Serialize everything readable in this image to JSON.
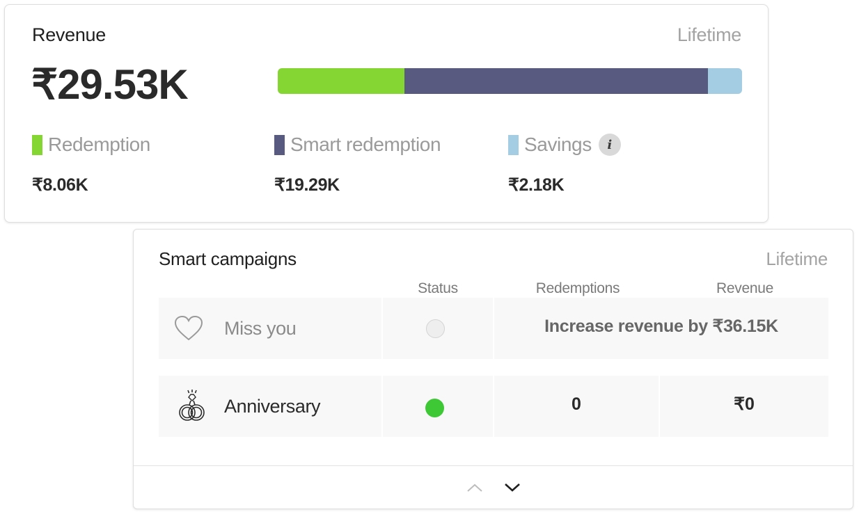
{
  "revenue": {
    "title": "Revenue",
    "period": "Lifetime",
    "total": "₹29.53K",
    "bar": [
      {
        "key": "redemption",
        "fraction": 0.273,
        "color": "#86d633"
      },
      {
        "key": "smart_redemption",
        "fraction": 0.653,
        "color": "#585a80"
      },
      {
        "key": "savings",
        "fraction": 0.074,
        "color": "#a4cce3"
      }
    ],
    "legend": [
      {
        "label": "Redemption",
        "value": "₹8.06K",
        "color": "#86d633"
      },
      {
        "label": "Smart redemption",
        "value": "₹19.29K",
        "color": "#585a80"
      },
      {
        "label": "Savings",
        "value": "₹2.18K",
        "color": "#a4cce3",
        "info_icon": "info-icon",
        "info_glyph": "i"
      }
    ]
  },
  "campaigns": {
    "title": "Smart campaigns",
    "period": "Lifetime",
    "columns": [
      "Status",
      "Redemptions",
      "Revenue"
    ],
    "rows": [
      {
        "icon": "heart-icon",
        "name": "Miss you",
        "status": "off",
        "status_color": "#eeeeee",
        "message": "Increase revenue by ₹36.15K"
      },
      {
        "icon": "rings-icon",
        "name": "Anniversary",
        "status": "on",
        "status_color": "#3fc836",
        "redemptions": "0",
        "revenue": "₹0"
      }
    ],
    "footer": {
      "up_icon": "chevron-up-icon",
      "down_icon": "chevron-down-icon"
    }
  }
}
